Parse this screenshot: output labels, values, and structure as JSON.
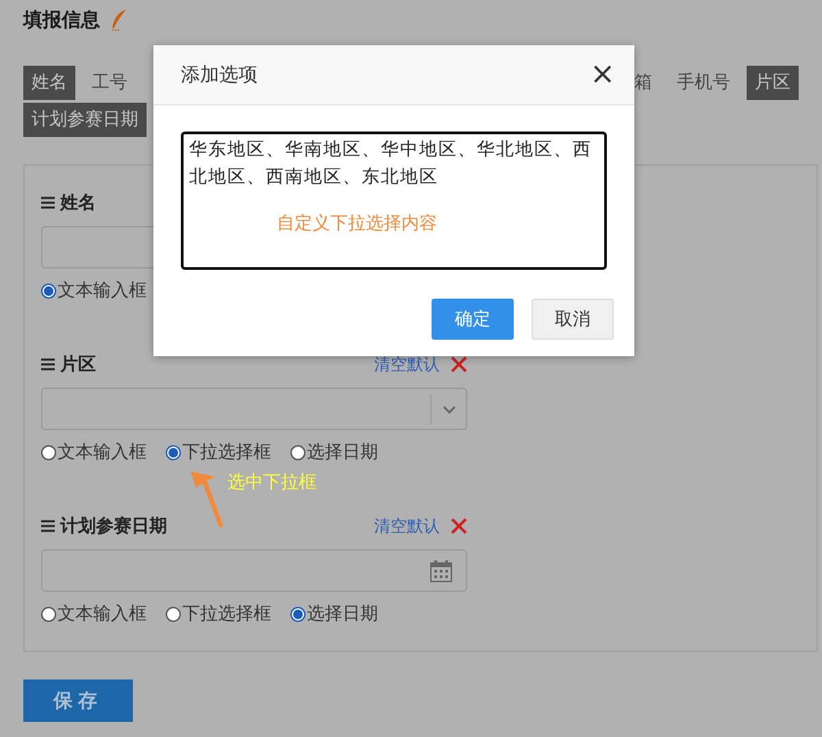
{
  "page": {
    "title": "填报信息"
  },
  "tab_rows": [
    {
      "tabs": [
        {
          "label": "姓名",
          "selected": true
        },
        {
          "label": "工号",
          "selected": false
        }
      ],
      "tabs_right": [
        {
          "label": "箱",
          "selected": false
        },
        {
          "label": "手机号",
          "selected": false
        },
        {
          "label": "片区",
          "selected": true
        }
      ]
    },
    {
      "tabs": [
        {
          "label": "计划参赛日期",
          "selected": true
        }
      ],
      "tabs_right": []
    }
  ],
  "fields": [
    {
      "label": "姓名",
      "kind": "text",
      "radios": [
        {
          "label": "文本输入框",
          "selected": true
        }
      ]
    },
    {
      "label": "片区",
      "kind": "select",
      "clear_link": "清空默认",
      "radios": [
        {
          "label": "文本输入框",
          "selected": false
        },
        {
          "label": "下拉选择框",
          "selected": true
        },
        {
          "label": "选择日期",
          "selected": false
        }
      ]
    },
    {
      "label": "计划参赛日期",
      "kind": "date",
      "clear_link": "清空默认",
      "radios": [
        {
          "label": "文本输入框",
          "selected": false
        },
        {
          "label": "下拉选择框",
          "selected": false
        },
        {
          "label": "选择日期",
          "selected": true
        }
      ]
    }
  ],
  "save_button": "保存",
  "modal": {
    "title": "添加选项",
    "close": "×",
    "textarea": "华东地区、华南地区、华中地区、华北地区、西北地区、西南地区、东北地区",
    "note": "自定义下拉选择内容",
    "buttons": [
      {
        "label": "确定",
        "kind": "primary"
      },
      {
        "label": "取消",
        "kind": "default"
      }
    ]
  },
  "annotation": {
    "text": "选中下拉框"
  }
}
